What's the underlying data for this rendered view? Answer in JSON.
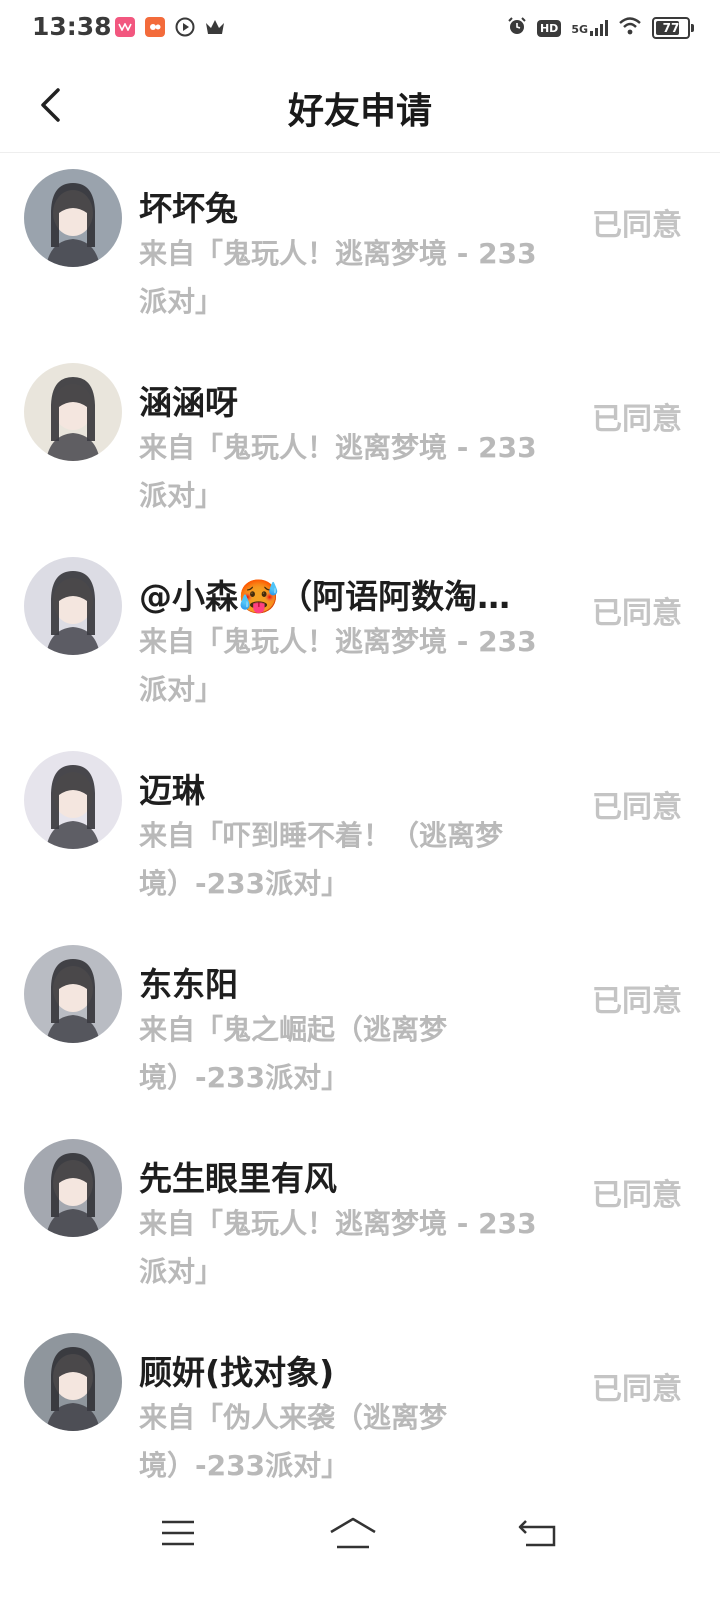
{
  "status_bar": {
    "time": "13:38",
    "network": "5G",
    "hd_label": "HD",
    "battery": "77",
    "battery_level": 0.77,
    "icons": [
      "video-app-icon",
      "shopping-app-icon",
      "play-app-icon",
      "crown-app-icon",
      "alarm-icon",
      "hd-icon",
      "signal-icon",
      "wifi-icon",
      "battery-icon"
    ]
  },
  "header": {
    "title": "好友申请",
    "back_icon": "chevron-left-icon"
  },
  "requests": [
    {
      "name": "坏坏兔",
      "source": "来自「鬼玩人！逃离梦境 - 233派对」",
      "status": "已同意",
      "avatar_bg": "#9aa3ad"
    },
    {
      "name": "涵涵呀",
      "source": "来自「鬼玩人！逃离梦境 - 233派对」",
      "status": "已同意",
      "avatar_bg": "#e9e5dc"
    },
    {
      "name": "@小森🥵（阿语阿数淘…",
      "source": "来自「鬼玩人！逃离梦境 - 233派对」",
      "status": "已同意",
      "avatar_bg": "#dcdce4"
    },
    {
      "name": "迈琳",
      "source": "来自「吓到睡不着！（逃离梦境）-233派对」",
      "status": "已同意",
      "avatar_bg": "#e6e4ec"
    },
    {
      "name": "东东阳",
      "source": "来自「鬼之崛起（逃离梦境）-233派对」",
      "status": "已同意",
      "avatar_bg": "#b9bcc3"
    },
    {
      "name": "先生眼里有风",
      "source": "来自「鬼玩人！逃离梦境 - 233派对」",
      "status": "已同意",
      "avatar_bg": "#a4a8b0"
    },
    {
      "name": "顾妍(找对象)",
      "source": "来自「伪人来袭（逃离梦境）-233派对」",
      "status": "已同意",
      "avatar_bg": "#8f969d"
    }
  ],
  "nav": {
    "icons": [
      "menu-icon",
      "home-icon",
      "back-icon"
    ]
  },
  "colors": {
    "title": "#1a1a1a",
    "source_text": "#b9b9b9",
    "status_text": "#c4c4c4",
    "divider": "#eeeeee"
  }
}
